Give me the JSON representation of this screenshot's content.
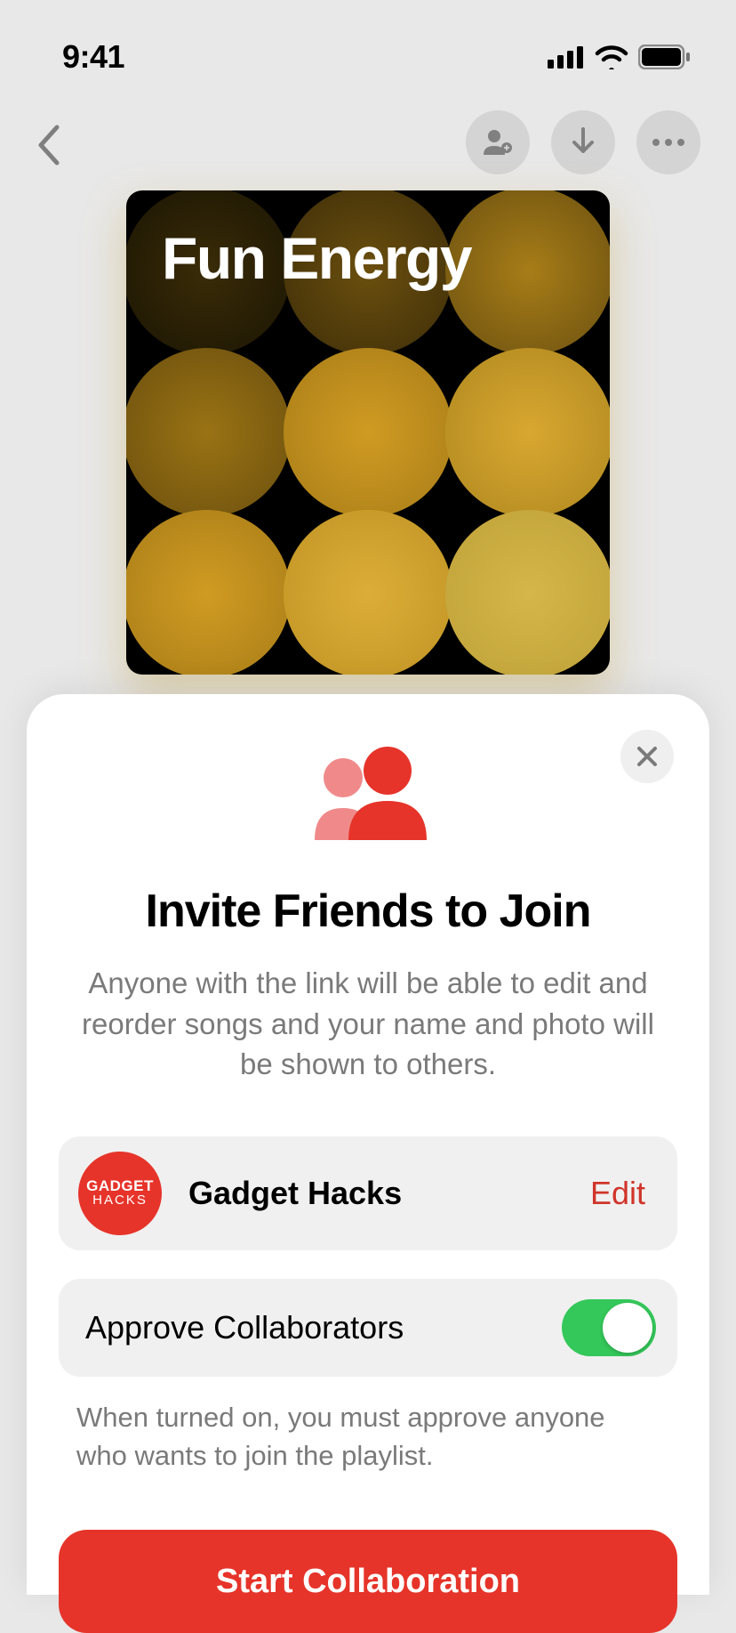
{
  "status": {
    "time": "9:41"
  },
  "playlist": {
    "title": "Fun Energy"
  },
  "sheet": {
    "title": "Invite Friends to Join",
    "description": "Anyone with the link will be able to edit and reorder songs and your name and photo will be shown to others.",
    "user": {
      "name": "Gadget Hacks",
      "avatar_line1": "GADGET",
      "avatar_line2": "HACKS",
      "edit_label": "Edit"
    },
    "approve": {
      "label": "Approve Collaborators",
      "note": "When turned on, you must approve anyone who wants to join the playlist.",
      "enabled": true
    },
    "cta": "Start Collaboration"
  }
}
